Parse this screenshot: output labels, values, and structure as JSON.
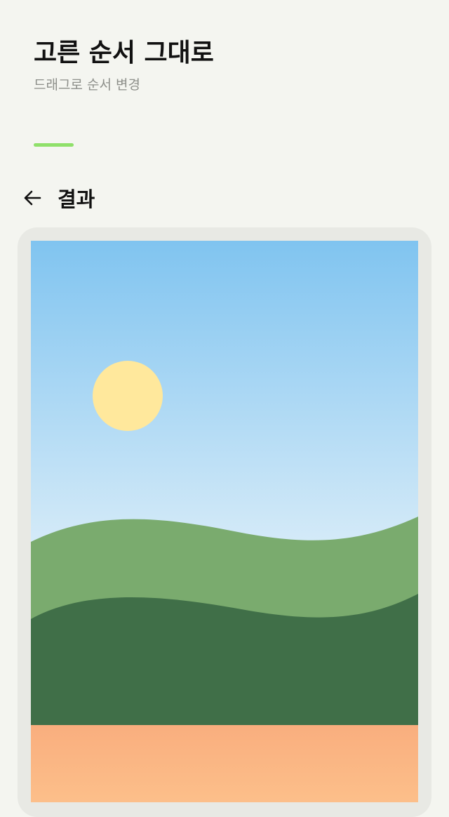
{
  "header": {
    "title": "고른 순서 그대로",
    "subtitle": "드래그로 순서 변경"
  },
  "colors": {
    "background": "#f4f5f0",
    "accent": "#8fe06a",
    "card": "#e8e9e4",
    "sky_top": "#80c4f0",
    "sky_bottom": "#d6ebf8",
    "sun": "#ffe89c",
    "hill_light": "#7aab6e",
    "hill_dark": "#406f48",
    "ground_top": "#f9ae7e",
    "ground_bottom": "#fcbf8a"
  },
  "toolbar": {
    "back_icon": "arrow-left-icon",
    "title": "결과"
  }
}
